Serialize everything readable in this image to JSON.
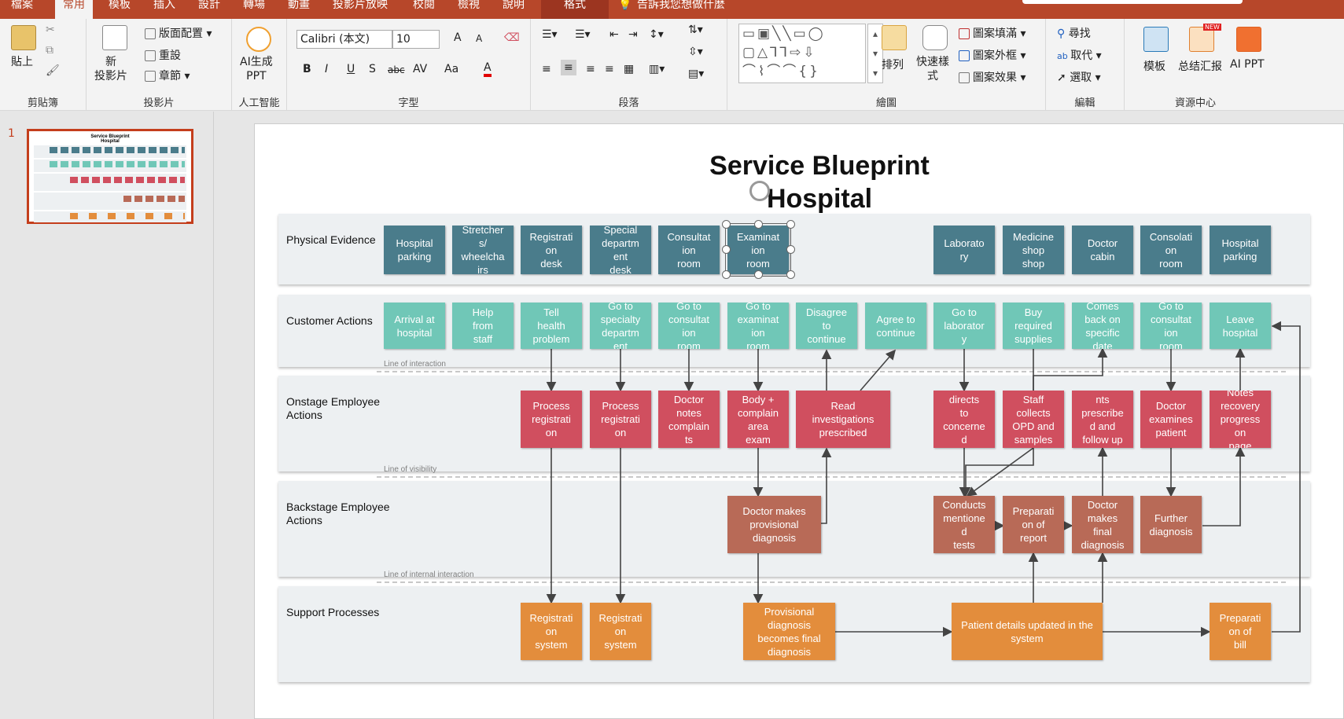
{
  "tabs": [
    "檔案",
    "常用",
    "模板",
    "插入",
    "設計",
    "轉場",
    "動畫",
    "投影片放映",
    "校閱",
    "檢視",
    "說明",
    "格式"
  ],
  "tell_me": "告訴我您想做什麼",
  "ribbon": {
    "clipboard": {
      "paste": "貼上",
      "label": "剪貼簿"
    },
    "slides": {
      "new_slide": "新\n投影片",
      "layout": "版面配置",
      "reset": "重設",
      "section": "章節",
      "label": "投影片"
    },
    "ai": {
      "generate": "AI生成\nPPT",
      "label": "人工智能"
    },
    "font": {
      "name": "Calibri (本文)",
      "size": "10",
      "label": "字型",
      "bold": "B",
      "italic": "I",
      "underline": "U",
      "shadow": "S",
      "strike": "abc",
      "spacing": "AV",
      "case": "Aa",
      "color": "A",
      "grow": "A",
      "shrink": "A"
    },
    "paragraph": {
      "label": "段落"
    },
    "drawing": {
      "arrange": "排列",
      "quick_styles": "快速樣\n式",
      "fill": "圖案填滿",
      "outline": "圖案外框",
      "effects": "圖案效果",
      "label": "繪圖"
    },
    "editing": {
      "find": "尋找",
      "replace": "取代",
      "select": "選取",
      "label": "編輯"
    },
    "resources": {
      "templates": "模板",
      "summary": "总结汇报",
      "ai_ppt": "AI PPT",
      "new_badge": "NEW",
      "label": "資源中心"
    }
  },
  "slide_number": "1",
  "slide": {
    "title_line1": "Service Blueprint",
    "title_line2": "Hospital",
    "lanes": [
      "Physical Evidence",
      "Customer Actions",
      "Onstage Employee\nActions",
      "Backstage Employee\nActions",
      "Support Processes"
    ],
    "separators": [
      "Line of interaction",
      "Line of visibility",
      "Line of internal interaction"
    ],
    "physical_evidence": [
      "Hospital\nparking",
      "Stretcher\ns/\nwheelcha\nirs",
      "Registrati\non\ndesk",
      "Special\ndepartm\nent\ndesk",
      "Consultat\nion\nroom",
      "Examinat\nion\nroom",
      "Laborato\nry",
      "Medicine\nshop\nshop",
      "Doctor\ncabin",
      "Consolati\non\nroom",
      "Hospital\nparking"
    ],
    "customer_actions": [
      "Arrival at\nhospital",
      "Help\nfrom\nstaff",
      "Tell\nhealth\nproblem",
      "Go to\nspecialty\ndepartm\nent",
      "Go to\nconsultat\nion\nroom",
      "Go to\nexaminat\nion\nroom",
      "Disagree\nto\ncontinue",
      "Agree to\ncontinue",
      "Go to\nlaborator\ny",
      "Buy\nrequired\nsupplies",
      "Comes\nback on\nspecific\ndate",
      "Go to\nconsultat\nion\nroom",
      "Leave\nhospital"
    ],
    "onstage": [
      "Process\nregistrati\non",
      "Process\nregistrati\non",
      "Doctor\nnotes\ncomplain\nts",
      "Body +\ncomplain\narea\nexam",
      "Read\ninvestigations\nprescribed",
      "Doctor\ndirects\nto\nconcerne\nd\nlab",
      "Staff\ncollects\nOPD and\nsamples",
      "Treatme\nnts\nprescribe\nd and\nfollow up\ndate",
      "Doctor\nexamines\npatient",
      "Notes\nrecovery\nprogress\non\npage"
    ],
    "backstage": [
      "Doctor makes\nprovisional\ndiagnosis",
      "Conducts\nmentione\nd\ntests",
      "Preparati\non of\nreport",
      "Doctor\nmakes\nfinal\ndiagnosis",
      "Further\ndiagnosis"
    ],
    "support": [
      "Registrati\non\nsystem",
      "Registrati\non\nsystem",
      "Provisional\ndiagnosis\nbecomes final\ndiagnosis",
      "Patient details updated in the\nsystem",
      "Preparati\non of\nbill"
    ]
  },
  "thumbnail": {
    "title_line1": "Service Blueprint",
    "title_line2": "Hospital"
  }
}
